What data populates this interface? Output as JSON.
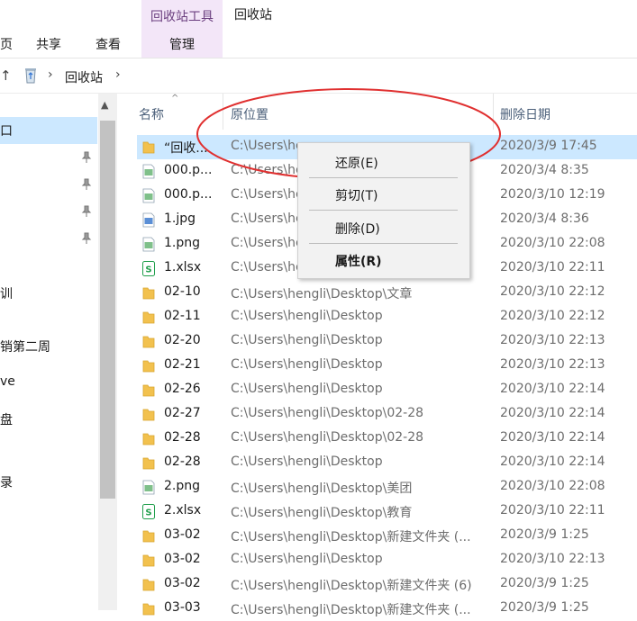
{
  "ribbon": {
    "tabs": [
      "页",
      "共享",
      "查看"
    ],
    "context_group_title": "回收站工具",
    "context_tab": "管理",
    "window_title": "回收站"
  },
  "address": {
    "breadcrumb": "回收站"
  },
  "nav": {
    "items": [
      "训",
      "销第二周",
      "ve",
      "盘",
      "录"
    ],
    "selected_label": "口"
  },
  "columns": {
    "name": "名称",
    "location": "原位置",
    "date": "删除日期"
  },
  "files": [
    {
      "name": "“回收...",
      "location": "C:\\Users\\he",
      "date": "2020/3/9 17:45",
      "icon": "folder",
      "selected": true
    },
    {
      "name": "000.p...",
      "location": "C:\\Users\\he",
      "date": "2020/3/4 8:35",
      "icon": "image-green"
    },
    {
      "name": "000.p...",
      "location": "C:\\Users\\he",
      "date": "2020/3/10 12:19",
      "icon": "image-green"
    },
    {
      "name": "1.jpg",
      "location": "C:\\Users\\he",
      "date": "2020/3/4 8:36",
      "icon": "image-blue"
    },
    {
      "name": "1.png",
      "location": "C:\\Users\\he",
      "date": "2020/3/10 22:08",
      "icon": "image-green"
    },
    {
      "name": "1.xlsx",
      "location": "C:\\Users\\he",
      "date": "2020/3/10 22:11",
      "icon": "sheet"
    },
    {
      "name": "02-10",
      "location": "C:\\Users\\hengli\\Desktop\\文章",
      "date": "2020/3/10 22:12",
      "icon": "folder"
    },
    {
      "name": "02-11",
      "location": "C:\\Users\\hengli\\Desktop",
      "date": "2020/3/10 22:12",
      "icon": "folder"
    },
    {
      "name": "02-20",
      "location": "C:\\Users\\hengli\\Desktop",
      "date": "2020/3/10 22:13",
      "icon": "folder"
    },
    {
      "name": "02-21",
      "location": "C:\\Users\\hengli\\Desktop",
      "date": "2020/3/10 22:13",
      "icon": "folder"
    },
    {
      "name": "02-26",
      "location": "C:\\Users\\hengli\\Desktop",
      "date": "2020/3/10 22:14",
      "icon": "folder"
    },
    {
      "name": "02-27",
      "location": "C:\\Users\\hengli\\Desktop\\02-28",
      "date": "2020/3/10 22:14",
      "icon": "folder"
    },
    {
      "name": "02-28",
      "location": "C:\\Users\\hengli\\Desktop\\02-28",
      "date": "2020/3/10 22:14",
      "icon": "folder"
    },
    {
      "name": "02-28",
      "location": "C:\\Users\\hengli\\Desktop",
      "date": "2020/3/10 22:14",
      "icon": "folder"
    },
    {
      "name": "2.png",
      "location": "C:\\Users\\hengli\\Desktop\\美团",
      "date": "2020/3/10 22:08",
      "icon": "image-green"
    },
    {
      "name": "2.xlsx",
      "location": "C:\\Users\\hengli\\Desktop\\教育",
      "date": "2020/3/10 22:11",
      "icon": "sheet"
    },
    {
      "name": "03-02",
      "location": "C:\\Users\\hengli\\Desktop\\新建文件夹 (...",
      "date": "2020/3/9 1:25",
      "icon": "folder"
    },
    {
      "name": "03-02",
      "location": "C:\\Users\\hengli\\Desktop",
      "date": "2020/3/10 22:13",
      "icon": "folder"
    },
    {
      "name": "03-02",
      "location": "C:\\Users\\hengli\\Desktop\\新建文件夹 (6)",
      "date": "2020/3/9 1:25",
      "icon": "folder"
    },
    {
      "name": "03-03",
      "location": "C:\\Users\\hengli\\Desktop\\新建文件夹 (...",
      "date": "2020/3/9 1:25",
      "icon": "folder"
    }
  ],
  "context_menu": {
    "restore": "还原(E)",
    "cut": "剪切(T)",
    "delete": "删除(D)",
    "properties": "属性(R)"
  },
  "colors": {
    "selection": "#cce8ff",
    "context_group": "#f3e6f8",
    "annotation": "#e03030",
    "folder": "#f2c14e",
    "sheet": "#1e9e4a"
  }
}
